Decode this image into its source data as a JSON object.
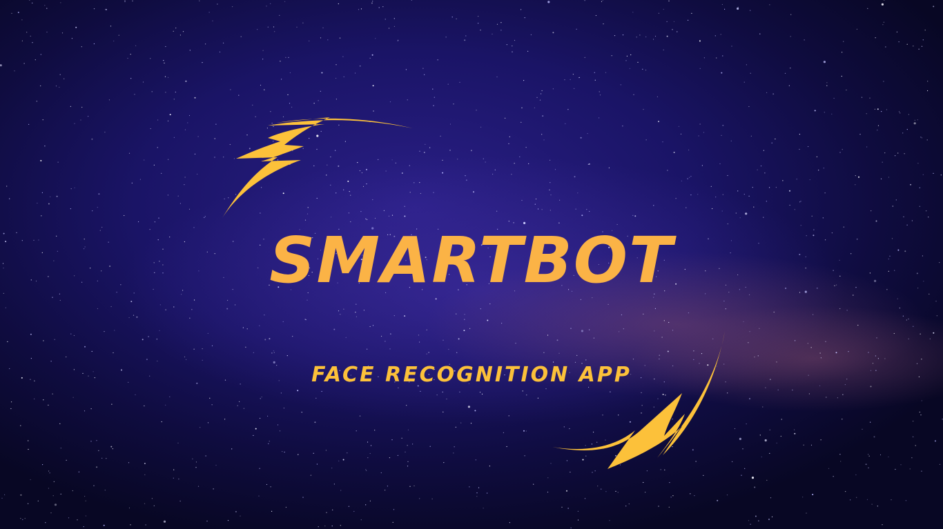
{
  "brand": {
    "title": "SMARTBOT",
    "subtitle": "FACE RECOGNITION APP"
  },
  "colors": {
    "title": "#fbb346",
    "subtitle": "#fcc13a",
    "bolt": "#fcc13a",
    "background": "#1a1466"
  },
  "icons": {
    "top_swoosh": "lightning-swoosh-icon",
    "bottom_swoosh": "lightning-swoosh-icon"
  }
}
